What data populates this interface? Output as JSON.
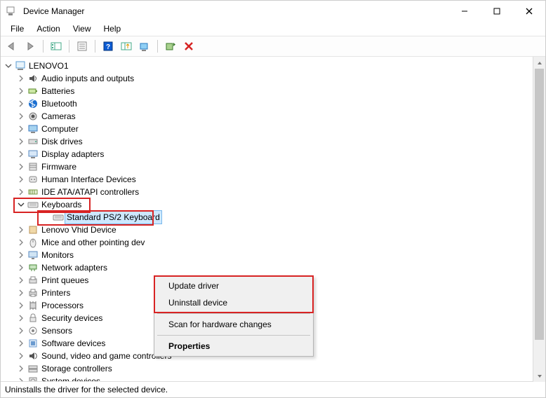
{
  "title": "Device Manager",
  "menus": {
    "file": "File",
    "action": "Action",
    "view": "View",
    "help": "Help"
  },
  "root": "LENOVO1",
  "nodes": [
    {
      "label": "Audio inputs and outputs",
      "icon": "speaker"
    },
    {
      "label": "Batteries",
      "icon": "battery"
    },
    {
      "label": "Bluetooth",
      "icon": "bluetooth"
    },
    {
      "label": "Cameras",
      "icon": "camera"
    },
    {
      "label": "Computer",
      "icon": "monitor"
    },
    {
      "label": "Disk drives",
      "icon": "drive"
    },
    {
      "label": "Display adapters",
      "icon": "display"
    },
    {
      "label": "Firmware",
      "icon": "firmware"
    },
    {
      "label": "Human Interface Devices",
      "icon": "hid"
    },
    {
      "label": "IDE ATA/ATAPI controllers",
      "icon": "ide"
    },
    {
      "label": "Keyboards",
      "icon": "keyboard",
      "expanded": true
    },
    {
      "label": "Lenovo Vhid Device",
      "icon": "lenovo"
    },
    {
      "label": "Mice and other pointing dev",
      "icon": "mouse",
      "cut": true
    },
    {
      "label": "Monitors",
      "icon": "monitor2"
    },
    {
      "label": "Network adapters",
      "icon": "network"
    },
    {
      "label": "Print queues",
      "icon": "printq"
    },
    {
      "label": "Printers",
      "icon": "printer"
    },
    {
      "label": "Processors",
      "icon": "cpu"
    },
    {
      "label": "Security devices",
      "icon": "lock"
    },
    {
      "label": "Sensors",
      "icon": "sensor"
    },
    {
      "label": "Software devices",
      "icon": "software"
    },
    {
      "label": "Sound, video and game controllers",
      "icon": "sound"
    },
    {
      "label": "Storage controllers",
      "icon": "storage"
    },
    {
      "label": "System devices",
      "icon": "system",
      "cut": true
    }
  ],
  "keyboard_child": "Standard PS/2 Keyboard",
  "context": {
    "update": "Update driver",
    "uninstall": "Uninstall device",
    "scan": "Scan for hardware changes",
    "props": "Properties"
  },
  "status": "Uninstalls the driver for the selected device."
}
